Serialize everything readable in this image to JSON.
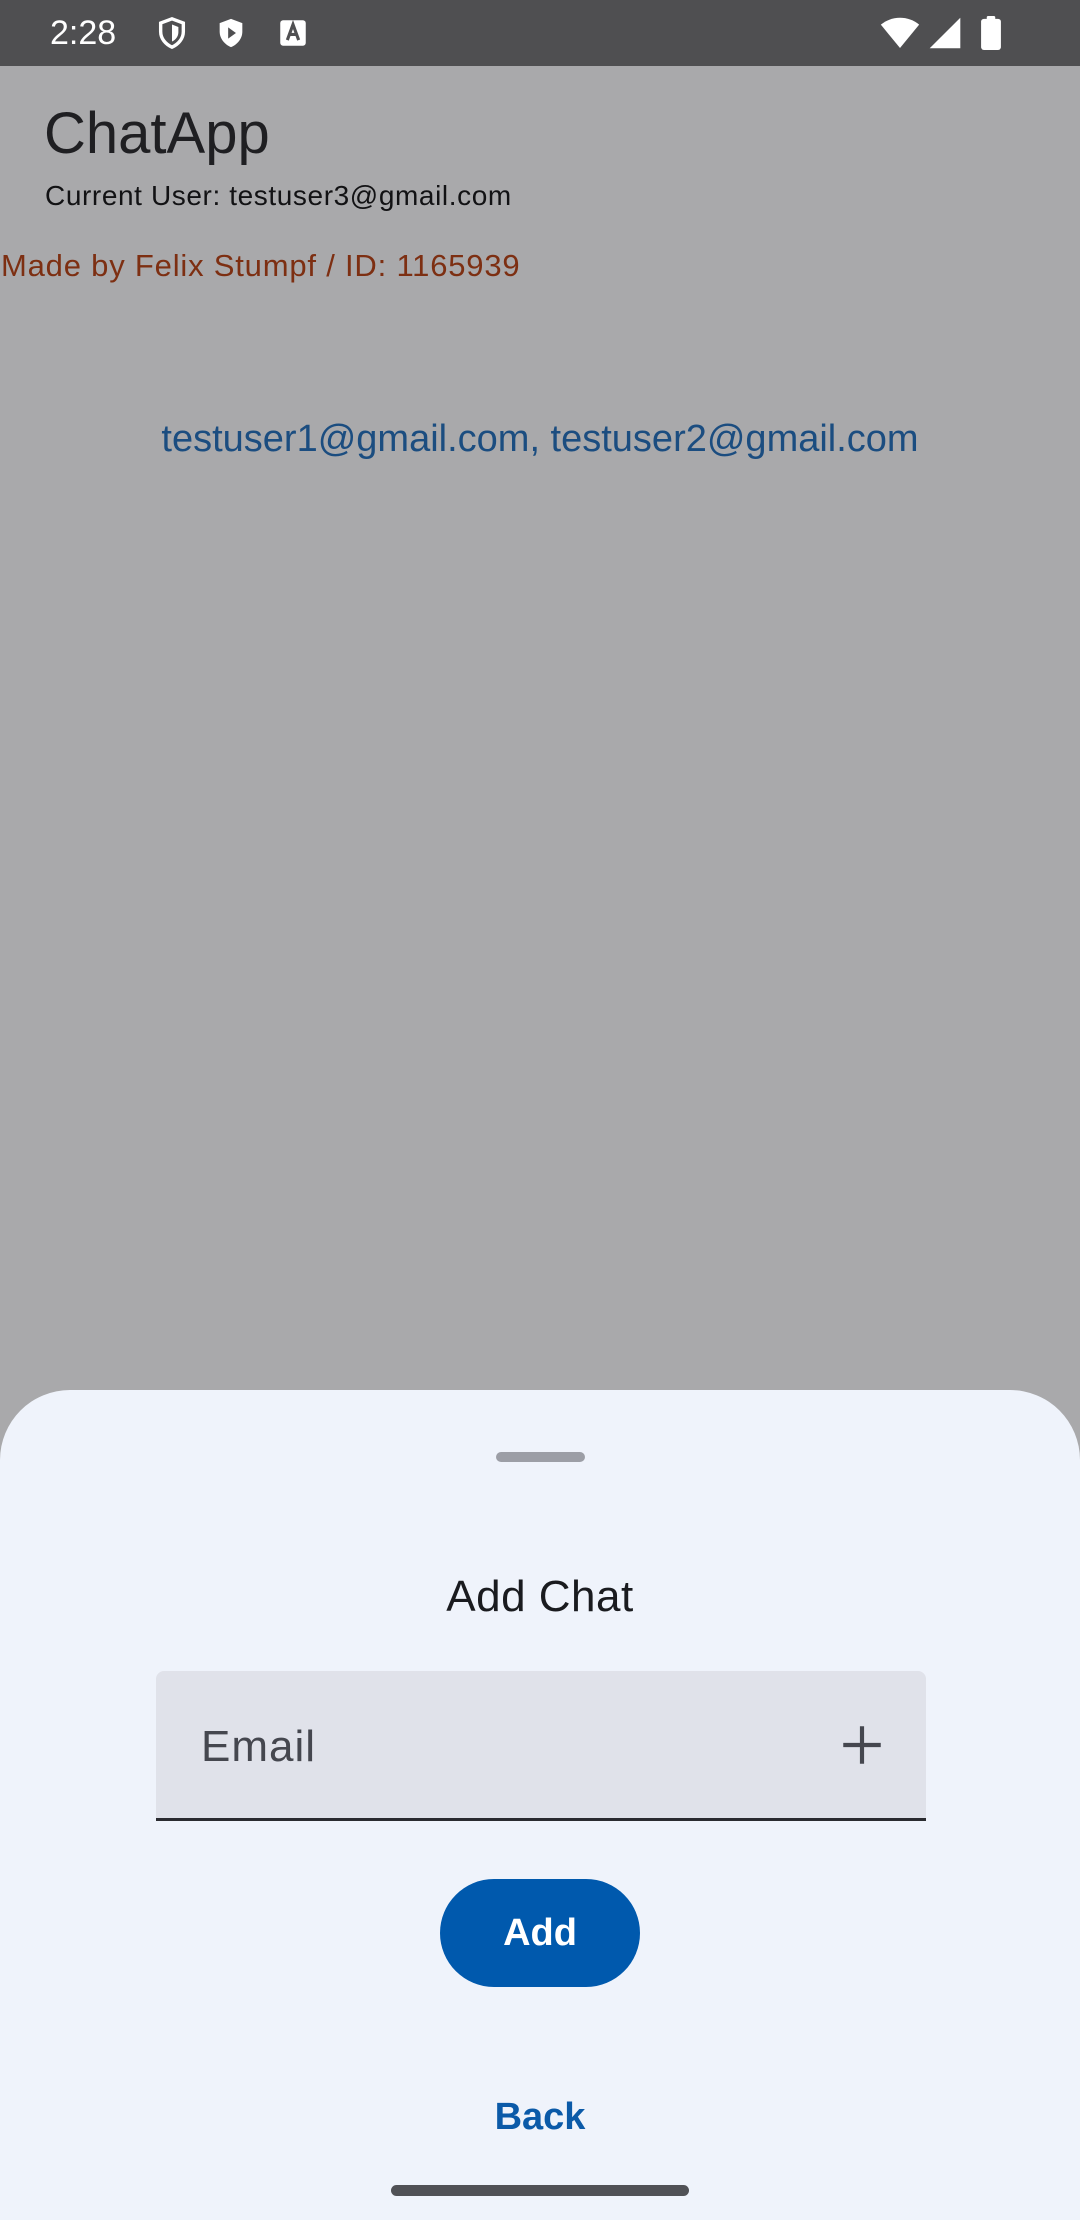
{
  "status_bar": {
    "time": "2:28",
    "left_icons": [
      "shield-icon",
      "play-shield-icon",
      "font-icon"
    ],
    "right_icons": [
      "wifi-icon",
      "cellular-signal-icon",
      "battery-icon"
    ]
  },
  "app": {
    "title": "ChatApp",
    "current_user": "Current User: testuser3@gmail.com",
    "made_by": "Made by Felix Stumpf / ID: 1165939",
    "chats": [
      {
        "participants": "testuser1@gmail.com, testuser2@gmail.com"
      }
    ]
  },
  "sheet": {
    "title": "Add Chat",
    "email_field": {
      "placeholder": "Email",
      "value": "",
      "icon": "plus-icon"
    },
    "add_label": "Add",
    "back_label": "Back"
  },
  "colors": {
    "primary": "#0059ad",
    "scrim": "#a9a9ab",
    "sheet_background": "#eff3fb",
    "made_by_text": "#7d2f12",
    "chat_link": "#1b4d80"
  }
}
